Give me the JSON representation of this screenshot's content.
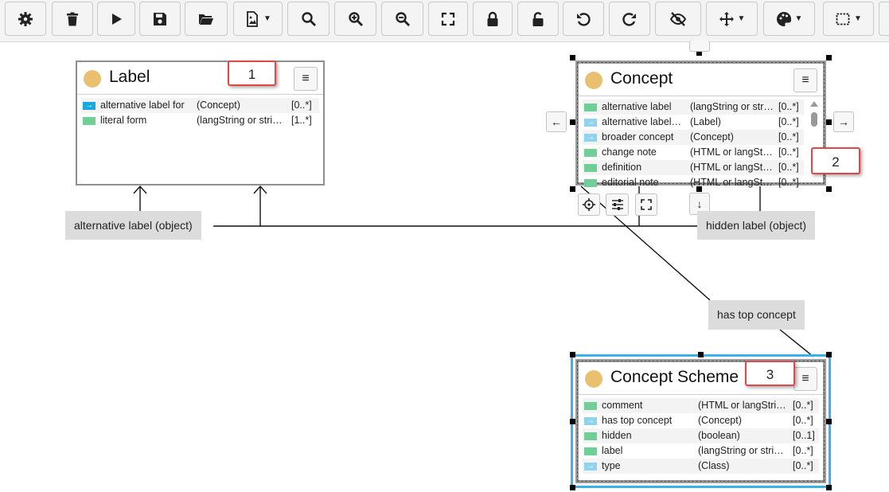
{
  "toolbar": {
    "buttons": [
      {
        "name": "settings-button",
        "icon": "gear-icon"
      },
      {
        "name": "delete-button",
        "icon": "trash-icon"
      },
      {
        "name": "run-button",
        "icon": "play-icon"
      },
      {
        "name": "save-button",
        "icon": "floppy-disk-icon"
      },
      {
        "name": "open-button",
        "icon": "folder-open-icon"
      },
      {
        "name": "export-image-button",
        "icon": "file-image-icon"
      },
      {
        "name": "search-button",
        "icon": "search-icon"
      },
      {
        "name": "zoom-in-button",
        "icon": "zoom-in-icon"
      },
      {
        "name": "zoom-out-button",
        "icon": "zoom-out-icon"
      },
      {
        "name": "fit-button",
        "icon": "expand-icon"
      },
      {
        "name": "lock-button",
        "icon": "lock-icon"
      },
      {
        "name": "unlock-button",
        "icon": "unlock-icon"
      },
      {
        "name": "undo-button",
        "icon": "undo-icon"
      },
      {
        "name": "redo-button",
        "icon": "redo-icon"
      },
      {
        "name": "hide-button",
        "icon": "eye-slash-icon"
      },
      {
        "name": "layout-button",
        "icon": "move-arrows-icon"
      },
      {
        "name": "color-button",
        "icon": "palette-icon"
      },
      {
        "name": "frame-button",
        "icon": "dashed-frame-icon"
      }
    ]
  },
  "cards": {
    "label": {
      "title": "Label",
      "rows": [
        {
          "kind": "rel-active",
          "name": "alternative label for",
          "type": "(Concept)",
          "card": "[0..*]"
        },
        {
          "kind": "attr",
          "name": "literal form",
          "type": "(langString or stri…",
          "card": "[1..*]"
        }
      ]
    },
    "concept": {
      "title": "Concept",
      "rows": [
        {
          "kind": "attr",
          "name": "alternative label",
          "type": "(langString or str…",
          "card": "[0..*]"
        },
        {
          "kind": "rel",
          "name": "alternative label…",
          "type": "(Label)",
          "card": "[0..*]"
        },
        {
          "kind": "rel",
          "name": "broader concept",
          "type": "(Concept)",
          "card": "[0..*]"
        },
        {
          "kind": "attr",
          "name": "change note",
          "type": "(HTML or langSt…",
          "card": "[0..*]"
        },
        {
          "kind": "attr",
          "name": "definition",
          "type": "(HTML or langSt…",
          "card": "[0..*]"
        },
        {
          "kind": "attr",
          "name": "editorial note",
          "type": "(HTML or langSt…",
          "card": "[0..*]"
        }
      ]
    },
    "scheme": {
      "title": "Concept Scheme",
      "rows": [
        {
          "kind": "attr",
          "name": "comment",
          "type": "(HTML or langStri…",
          "card": "[0..*]"
        },
        {
          "kind": "rel",
          "name": "has top concept",
          "type": "(Concept)",
          "card": "[0..*]"
        },
        {
          "kind": "attr",
          "name": "hidden",
          "type": "(boolean)",
          "card": "[0..1]"
        },
        {
          "kind": "attr",
          "name": "label",
          "type": "(langString or stri…",
          "card": "[0..*]"
        },
        {
          "kind": "rel",
          "name": "type",
          "type": "(Class)",
          "card": "[0..*]"
        }
      ]
    }
  },
  "edges": {
    "alt_label": "alternative label (object)",
    "hidden_label": "hidden label (object)",
    "top_concept": "has top concept"
  },
  "callouts": {
    "one": "1",
    "two": "2",
    "three": "3"
  },
  "colors": {
    "accent": "#3ab1ea",
    "circle": "#e8c070",
    "attribute": "#6fcf97",
    "relation": "#8fd3ee",
    "callout_border": "#e04848"
  }
}
